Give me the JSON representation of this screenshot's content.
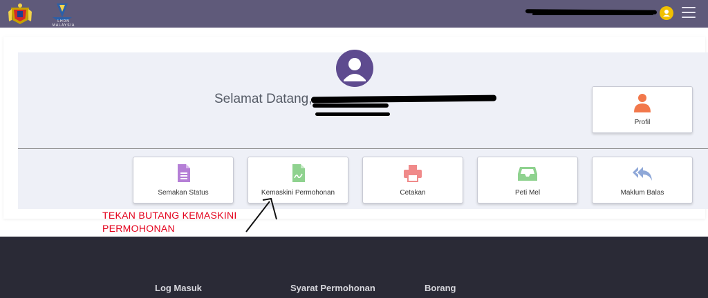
{
  "header": {
    "icons": {
      "crest": "jata-negara-logo",
      "agency": "lhdn-logo",
      "user": "user-avatar-icon",
      "menu": "hamburger-menu-icon"
    },
    "agency_logo_text": "LHDN MALAYSIA",
    "accent_color": "#5f5a7a"
  },
  "main": {
    "welcome_text": "Selamat Datang,",
    "profile_label": "Profil",
    "tiles": [
      {
        "label": "Semakan Status",
        "icon": "document-icon",
        "color": "#b57fd6"
      },
      {
        "label": "Kemaskini Permohonan",
        "icon": "edit-document-icon",
        "color": "#8fd28f"
      },
      {
        "label": "Cetakan",
        "icon": "printer-icon",
        "color": "#f08a8a"
      },
      {
        "label": "Peti Mel",
        "icon": "inbox-icon",
        "color": "#8fd28f"
      },
      {
        "label": "Maklum Balas",
        "icon": "reply-all-icon",
        "color": "#8fa8d8"
      }
    ]
  },
  "annotation": {
    "line1": "TEKAN BUTANG KEMASKINI",
    "line2": "PERMOHONAN"
  },
  "footer": {
    "links": [
      "Log Masuk",
      "Syarat Permohonan",
      "Borang"
    ]
  }
}
